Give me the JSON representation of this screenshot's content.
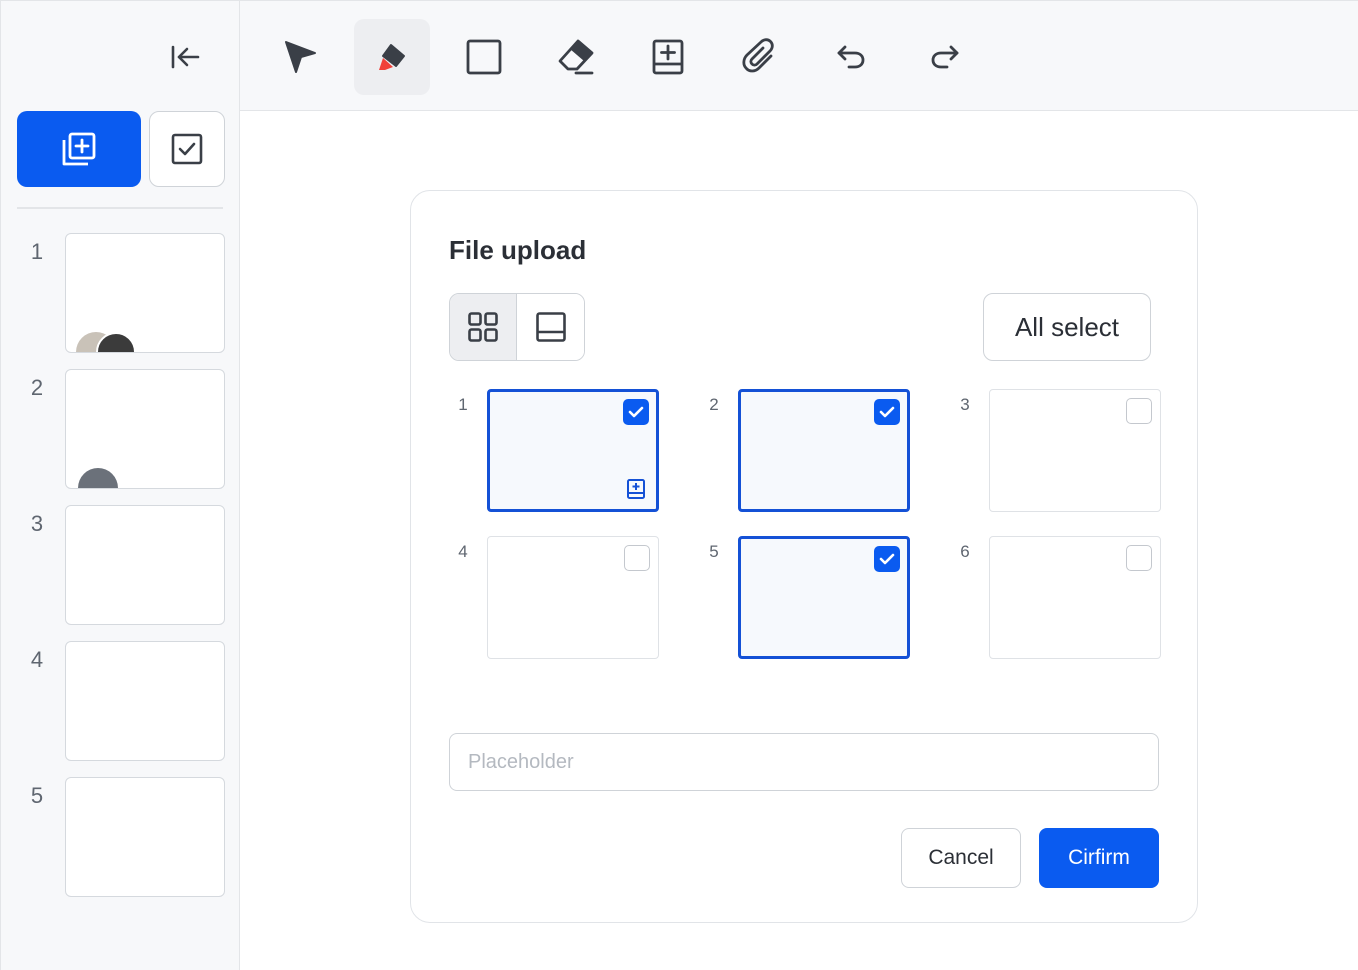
{
  "sidebar": {
    "collapse_icon": "collapse-left-icon",
    "add_page_icon": "add-page-icon",
    "select_icon": "checkbox-icon",
    "pages": [
      {
        "number": "1",
        "avatars": [
          "avatar-a",
          "avatar-b"
        ]
      },
      {
        "number": "2",
        "avatars": [
          "avatar-c"
        ]
      },
      {
        "number": "3",
        "avatars": []
      },
      {
        "number": "4",
        "avatars": []
      },
      {
        "number": "5",
        "avatars": []
      }
    ]
  },
  "toolbar": {
    "tools": [
      {
        "name": "select-tool",
        "icon": "cursor-arrow-icon",
        "active": false
      },
      {
        "name": "highlighter-tool",
        "icon": "highlighter-icon",
        "active": true
      },
      {
        "name": "rectangle-tool",
        "icon": "rectangle-icon",
        "active": false
      },
      {
        "name": "eraser-tool",
        "icon": "eraser-icon",
        "active": false
      },
      {
        "name": "add-page-tool",
        "icon": "add-page-icon",
        "active": false
      },
      {
        "name": "attach-tool",
        "icon": "paperclip-icon",
        "active": false
      },
      {
        "name": "undo-tool",
        "icon": "undo-icon",
        "active": false
      },
      {
        "name": "redo-tool",
        "icon": "redo-icon",
        "active": false
      }
    ],
    "accent_red": "#f0413a"
  },
  "dialog": {
    "title": "File upload",
    "view_modes": [
      {
        "icon": "grid-view-icon",
        "selected": true
      },
      {
        "icon": "single-view-icon",
        "selected": false
      }
    ],
    "all_select_label": "All select",
    "items": [
      {
        "number": "1",
        "checked": true,
        "has_badge": true
      },
      {
        "number": "2",
        "checked": true,
        "has_badge": false
      },
      {
        "number": "3",
        "checked": false,
        "has_badge": false
      },
      {
        "number": "4",
        "checked": false,
        "has_badge": false
      },
      {
        "number": "5",
        "checked": true,
        "has_badge": false
      },
      {
        "number": "6",
        "checked": false,
        "has_badge": false
      }
    ],
    "input": {
      "value": "",
      "placeholder": "Placeholder"
    },
    "cancel_label": "Cancel",
    "confirm_label": "Cirfirm"
  },
  "colors": {
    "primary": "#0a5bf0",
    "selected_border": "#1451d6"
  }
}
